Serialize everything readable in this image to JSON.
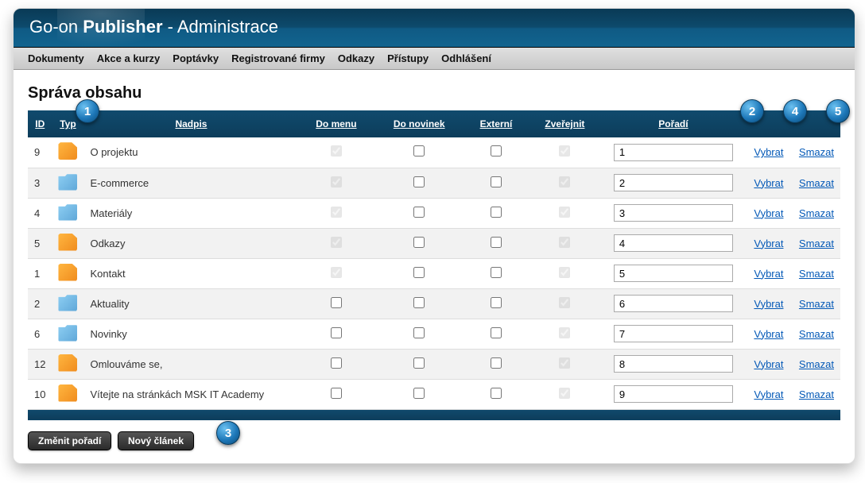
{
  "header": {
    "brand1": "Go-on ",
    "brand2": "Publisher",
    "suffix": " - Administrace"
  },
  "nav": [
    "Dokumenty",
    "Akce a kurzy",
    "Poptávky",
    "Registrované firmy",
    "Odkazy",
    "Přístupy",
    "Odhlášení"
  ],
  "page_title": "Správa obsahu",
  "columns": {
    "id": "ID",
    "type": "Typ",
    "title": "Nadpis",
    "menu": "Do menu",
    "news": "Do novinek",
    "external": "Externí",
    "publish": "Zveřejnit",
    "order": "Pořadí"
  },
  "actions": {
    "select": "Vybrat",
    "delete": "Smazat"
  },
  "rows": [
    {
      "id": "9",
      "type": "doc",
      "title": "O projektu",
      "menu": true,
      "menu_dis": true,
      "news": false,
      "ext": false,
      "pub": true,
      "pub_dis": true,
      "order": "1"
    },
    {
      "id": "3",
      "type": "folder",
      "title": "E-commerce",
      "menu": true,
      "menu_dis": true,
      "news": false,
      "ext": false,
      "pub": true,
      "pub_dis": true,
      "order": "2"
    },
    {
      "id": "4",
      "type": "folder",
      "title": "Materiály",
      "menu": true,
      "menu_dis": true,
      "news": false,
      "ext": false,
      "pub": true,
      "pub_dis": true,
      "order": "3"
    },
    {
      "id": "5",
      "type": "doc",
      "title": "Odkazy",
      "menu": true,
      "menu_dis": true,
      "news": false,
      "ext": false,
      "pub": true,
      "pub_dis": true,
      "order": "4"
    },
    {
      "id": "1",
      "type": "doc",
      "title": "Kontakt",
      "menu": true,
      "menu_dis": true,
      "news": false,
      "ext": false,
      "pub": true,
      "pub_dis": true,
      "order": "5"
    },
    {
      "id": "2",
      "type": "folder",
      "title": "Aktuality",
      "menu": false,
      "menu_dis": false,
      "news": false,
      "ext": false,
      "pub": true,
      "pub_dis": true,
      "order": "6"
    },
    {
      "id": "6",
      "type": "folder",
      "title": "Novinky",
      "menu": false,
      "menu_dis": false,
      "news": false,
      "ext": false,
      "pub": true,
      "pub_dis": true,
      "order": "7"
    },
    {
      "id": "12",
      "type": "doc",
      "title": "Omlouváme se,",
      "menu": false,
      "menu_dis": false,
      "news": false,
      "ext": false,
      "pub": true,
      "pub_dis": true,
      "order": "8"
    },
    {
      "id": "10",
      "type": "doc",
      "title": "Vítejte na stránkách MSK IT Academy",
      "menu": false,
      "menu_dis": false,
      "news": false,
      "ext": false,
      "pub": true,
      "pub_dis": true,
      "order": "9"
    }
  ],
  "buttons": {
    "reorder": "Změnit pořadí",
    "new": "Nový článek"
  },
  "callouts": {
    "1": "1",
    "2": "2",
    "3": "3",
    "4": "4",
    "5": "5"
  }
}
